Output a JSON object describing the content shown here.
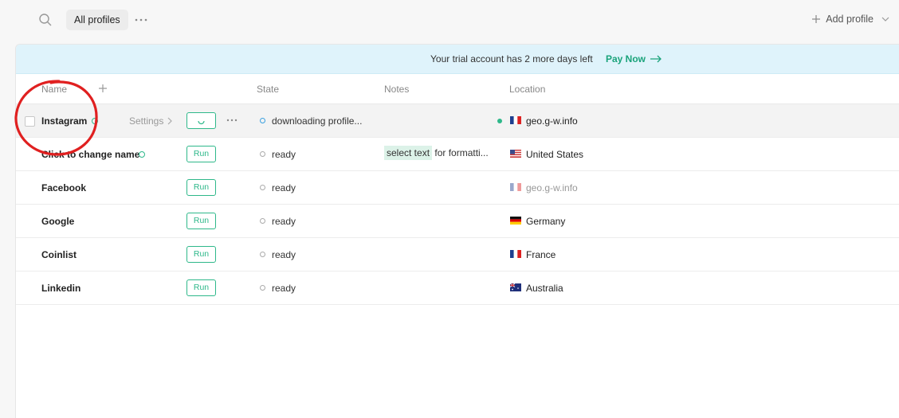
{
  "topbar": {
    "all_profiles_label": "All profiles",
    "add_profile_label": "Add profile"
  },
  "banner": {
    "message": "Your trial account has 2 more days left",
    "pay_now_label": "Pay Now",
    "background": "#dff3fb",
    "accent": "#1aa37b"
  },
  "table": {
    "columns": {
      "name": "Name",
      "state": "State",
      "notes": "Notes",
      "location": "Location"
    },
    "rows": [
      {
        "name": "Instagram",
        "settings_label": "Settings",
        "state": "downloading profile...",
        "notes": "",
        "location": "geo.g-w.info",
        "flag": "fr",
        "highlighted": true,
        "running": true
      },
      {
        "name": "Click to change name",
        "run_label": "Run",
        "state": "ready",
        "notes_highlight": "select text",
        "notes_rest": "for formatti...",
        "location": "United States",
        "flag": "us"
      },
      {
        "name": "Facebook",
        "run_label": "Run",
        "state": "ready",
        "notes": "",
        "location": "geo.g-w.info",
        "flag": "fr",
        "muted": true
      },
      {
        "name": "Google",
        "run_label": "Run",
        "state": "ready",
        "notes": "",
        "location": "Germany",
        "flag": "de"
      },
      {
        "name": "Coinlist",
        "run_label": "Run",
        "state": "ready",
        "notes": "",
        "location": "France",
        "flag": "fr"
      },
      {
        "name": "Linkedin",
        "run_label": "Run",
        "state": "ready",
        "notes": "",
        "location": "Australia",
        "flag": "au"
      }
    ]
  },
  "colors": {
    "primary": "#2eb88a",
    "annotation": "#e02020"
  }
}
